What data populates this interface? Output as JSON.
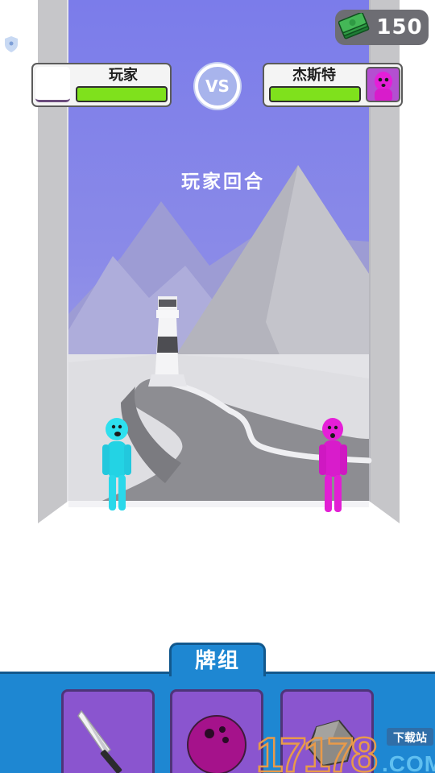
{
  "money": {
    "value": "150",
    "icon": "cash-stack-icon"
  },
  "player": {
    "name": "玩家",
    "health": 1.0
  },
  "enemy": {
    "name": "杰斯特",
    "health": 1.0
  },
  "vs_label": "VS",
  "turn_label": "玩家回合",
  "deck": {
    "tab_label": "牌组",
    "cards": [
      {
        "icon": "knife-icon"
      },
      {
        "icon": "bowling-ball-icon"
      },
      {
        "icon": "rock-icon"
      }
    ]
  },
  "watermark": {
    "number": "17178",
    "sub_label": "下载站",
    "domain": ".COM"
  },
  "colors": {
    "health": "#7fe11c",
    "deck": "#1e87d2",
    "card": "#8a55cf",
    "sky": "#7f81ea",
    "player_figure": "#2ee0ee",
    "enemy_figure": "#e51fd8"
  }
}
